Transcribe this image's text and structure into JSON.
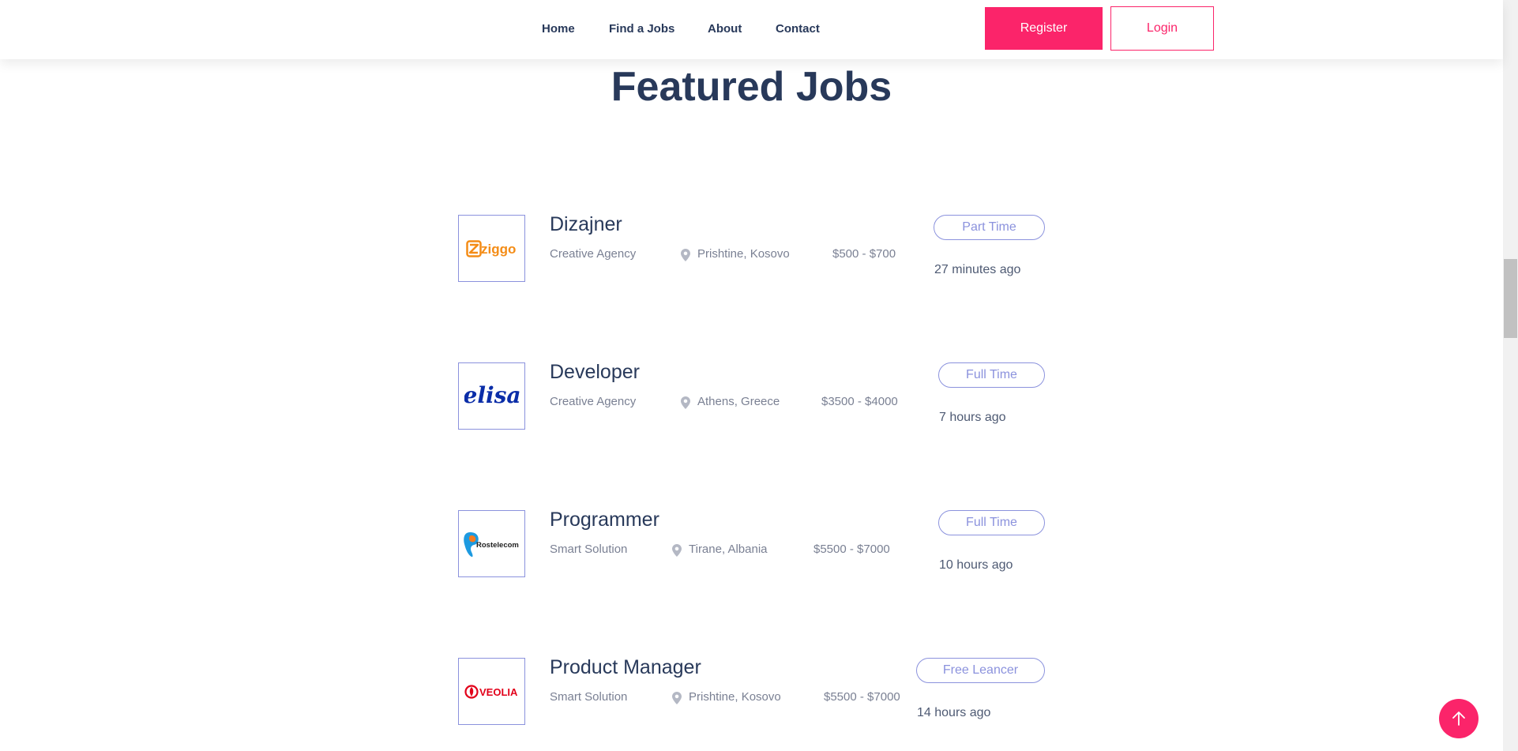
{
  "nav": {
    "items": [
      "Home",
      "Find a Jobs",
      "About",
      "Contact"
    ],
    "register": "Register",
    "login": "Login"
  },
  "section": {
    "title": "Featured Jobs"
  },
  "jobs": [
    {
      "title": "Dizajner",
      "company": "Creative Agency",
      "location": "Prishtine, Kosovo",
      "salary": "$500 - $700",
      "type": "Part Time",
      "posted": "27 minutes ago",
      "logo": "ziggo"
    },
    {
      "title": "Developer",
      "company": "Creative Agency",
      "location": "Athens, Greece",
      "salary": "$3500 - $4000",
      "type": "Full Time",
      "posted": "7 hours ago",
      "logo": "elisa"
    },
    {
      "title": "Programmer",
      "company": "Smart Solution",
      "location": "Tirane, Albania",
      "salary": "$5500 - $7000",
      "type": "Full Time",
      "posted": "10 hours ago",
      "logo": "Rostelecom"
    },
    {
      "title": "Product Manager",
      "company": "Smart Solution",
      "location": "Prishtine, Kosovo",
      "salary": "$5500 - $7000",
      "type": "Free Leancer",
      "posted": "14 hours ago",
      "logo": "VEOLIA"
    }
  ],
  "colors": {
    "accent": "#fb246a",
    "heading": "#28395a",
    "outline": "#8b92dd",
    "muted": "#7a8093"
  },
  "icons": {
    "location": "map-pin-icon",
    "back_to_top": "arrow-up-icon"
  }
}
